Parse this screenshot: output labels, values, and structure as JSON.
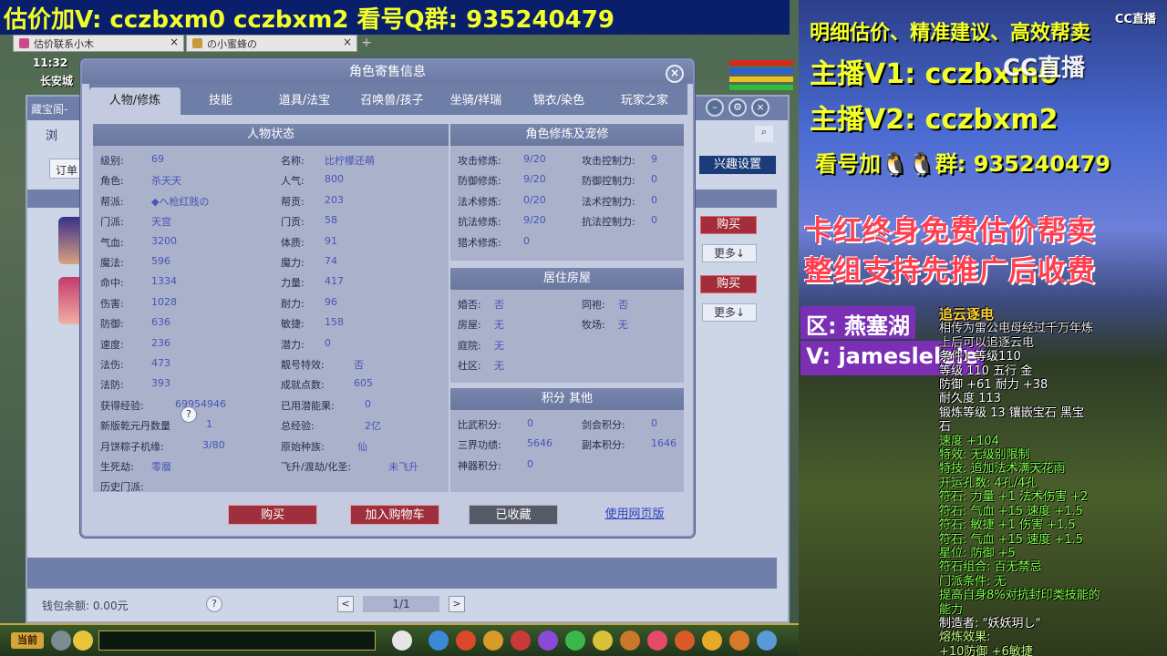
{
  "top_banner": {
    "text": "估价加V:  cczbxm0  cczbxm2  看号Q群: 935240479"
  },
  "browser_tabs": [
    {
      "label": "估价联系小木"
    },
    {
      "label": "の小蜜蜂の"
    }
  ],
  "game": {
    "time": "11:32",
    "city": "长安城",
    "shop_title": "藏宝阁-",
    "shop_sub": "浏",
    "order_label": "订单",
    "interest_button": "兴趣设置",
    "buy_label": "购买",
    "more_label": "更多↓",
    "wallet": "钱包余额: 0.00元",
    "help": "?",
    "page": "1/1",
    "prev": "<",
    "next": ">",
    "toolbar_current": "当前"
  },
  "dialog": {
    "title": "角色寄售信息",
    "close": "×",
    "tabs": [
      "人物/修炼",
      "技能",
      "道具/法宝",
      "召唤兽/孩子",
      "坐骑/祥瑞",
      "锦衣/染色",
      "玩家之家"
    ],
    "status_panel": {
      "title": "人物状态",
      "left": [
        {
          "k": "级别:",
          "v": "69"
        },
        {
          "k": "角色:",
          "v": "杀天天"
        },
        {
          "k": "帮派:",
          "v": "◆へ枪红贱の"
        },
        {
          "k": "门派:",
          "v": "天宫"
        },
        {
          "k": "气血:",
          "v": "3200"
        },
        {
          "k": "魔法:",
          "v": "596"
        },
        {
          "k": "命中:",
          "v": "1334"
        },
        {
          "k": "伤害:",
          "v": "1028"
        },
        {
          "k": "防御:",
          "v": "636"
        },
        {
          "k": "速度:",
          "v": "236"
        },
        {
          "k": "法伤:",
          "v": "473"
        },
        {
          "k": "法防:",
          "v": "393"
        },
        {
          "k": "获得经验:",
          "v": "69954946"
        },
        {
          "k": "新版乾元丹数量",
          "v": "1"
        },
        {
          "k": "月饼粽子机缘:",
          "v": "3/80"
        },
        {
          "k": "生死劫:",
          "v": "零層"
        },
        {
          "k": "历史门派:",
          "v": ""
        }
      ],
      "right": [
        {
          "k": "名称:",
          "v": "比柠檬还萌"
        },
        {
          "k": "人气:",
          "v": "800"
        },
        {
          "k": "帮贡:",
          "v": "203"
        },
        {
          "k": "门贡:",
          "v": "58"
        },
        {
          "k": "体质:",
          "v": "91"
        },
        {
          "k": "魔力:",
          "v": "74"
        },
        {
          "k": "力量:",
          "v": "417"
        },
        {
          "k": "耐力:",
          "v": "96"
        },
        {
          "k": "敏捷:",
          "v": "158"
        },
        {
          "k": "潜力:",
          "v": "0"
        },
        {
          "k": "靓号特效:",
          "v": "否"
        },
        {
          "k": "成就点数:",
          "v": "605"
        },
        {
          "k": "已用潜能果:",
          "v": "0"
        },
        {
          "k": "总经验:",
          "v": "2亿"
        },
        {
          "k": "原始种族:",
          "v": "仙"
        },
        {
          "k": "飞升/渡劫/化圣:",
          "v": "未飞升"
        }
      ]
    },
    "cultivation_panel": {
      "title": "角色修炼及宠修",
      "left": [
        {
          "k": "攻击修炼:",
          "v": "9/20"
        },
        {
          "k": "防御修炼:",
          "v": "9/20"
        },
        {
          "k": "法术修炼:",
          "v": "0/20"
        },
        {
          "k": "抗法修炼:",
          "v": "9/20"
        },
        {
          "k": "猎术修炼:",
          "v": "0"
        }
      ],
      "right": [
        {
          "k": "攻击控制力:",
          "v": "9"
        },
        {
          "k": "防御控制力:",
          "v": "0"
        },
        {
          "k": "法术控制力:",
          "v": "0"
        },
        {
          "k": "抗法控制力:",
          "v": "0"
        }
      ]
    },
    "house_panel": {
      "title": "居住房屋",
      "left": [
        {
          "k": "婚否:",
          "v": "否"
        },
        {
          "k": "房屋:",
          "v": "无"
        },
        {
          "k": "庭院:",
          "v": "无"
        },
        {
          "k": "社区:",
          "v": "无"
        }
      ],
      "right": [
        {
          "k": "同袍:",
          "v": "否"
        },
        {
          "k": "牧场:",
          "v": "无"
        }
      ]
    },
    "score_panel": {
      "title": "积分 其他",
      "left": [
        {
          "k": "比武积分:",
          "v": "0"
        },
        {
          "k": "三界功绩:",
          "v": "5646"
        },
        {
          "k": "神器积分:",
          "v": "0"
        }
      ],
      "right": [
        {
          "k": "剑会积分:",
          "v": "0"
        },
        {
          "k": "副本积分:",
          "v": "1646"
        }
      ]
    },
    "actions": {
      "buy": "购买",
      "add_cart": "加入购物车",
      "favorited": "已收藏",
      "web_version": "使用网页版"
    }
  },
  "stream": {
    "logo_small": "CC直播",
    "logo_big": "CC直播",
    "line1": "明细估价、精准建议、高效帮卖",
    "line2": "主播V1: cczbxm0",
    "line3": "主播V2: cczbxm2",
    "line4": "看号加🐧🐧群: 935240479",
    "red1": "卡红终身免费估价帮卖",
    "red2": "整组支持先推广后收费",
    "zone": "区: 燕塞湖",
    "wechat": "V: jameslelele",
    "item": [
      {
        "cls": "ii-title",
        "t": "追云逐电"
      },
      {
        "cls": "ii-desc",
        "t": "相传为雷公电母经过千万年炼"
      },
      {
        "cls": "ii-desc",
        "t": "                上后可以追逐云电"
      },
      {
        "cls": "ii-stat",
        "t": "        条件】等级110"
      },
      {
        "cls": "ii-stat",
        "t": "等级 110  五行 金"
      },
      {
        "cls": "ii-stat",
        "t": "防御 +61 耐力 +38"
      },
      {
        "cls": "ii-stat",
        "t": "耐久度 113"
      },
      {
        "cls": "ii-stat",
        "t": "锻炼等级 13  镶嵌宝石 黑宝"
      },
      {
        "cls": "ii-stat",
        "t": "石"
      },
      {
        "cls": "ii-green",
        "t": "速度 +104"
      },
      {
        "cls": "ii-green",
        "t": "特效: 无级别限制"
      },
      {
        "cls": "ii-green",
        "t": "特技: 追加法术满天花雨"
      },
      {
        "cls": "ii-green",
        "t": "开运孔数: 4孔/4孔"
      },
      {
        "cls": "ii-green",
        "t": "符石: 力量 +1 法术伤害 +2"
      },
      {
        "cls": "ii-green",
        "t": "符石: 气血 +15 速度 +1.5"
      },
      {
        "cls": "ii-green",
        "t": "符石: 敏捷 +1 伤害 +1.5"
      },
      {
        "cls": "ii-green",
        "t": "符石: 气血 +15 速度 +1.5"
      },
      {
        "cls": "ii-green",
        "t": "星位: 防御 +5"
      },
      {
        "cls": "ii-green",
        "t": "符石组合: 百无禁忌"
      },
      {
        "cls": "ii-green",
        "t": "门派条件: 无"
      },
      {
        "cls": "ii-green",
        "t": "提高自身8%对抗封印类技能的"
      },
      {
        "cls": "ii-green",
        "t": "能力"
      },
      {
        "cls": "ii-stat",
        "t": "制造者: \"妖妖玥し\""
      },
      {
        "cls": "ii-effect",
        "t": "熔炼效果:"
      },
      {
        "cls": "ii-effect",
        "t": "+10防御 +6敏捷"
      }
    ]
  },
  "colors": {
    "banner_bg": "#0a1f6b",
    "banner_text": "#f3ff2a",
    "dialog_bg": "#c4cbe0",
    "panel_head": "#6f7ea6",
    "buy_red": "#9e2f3c",
    "value_blue": "#4756b5"
  }
}
